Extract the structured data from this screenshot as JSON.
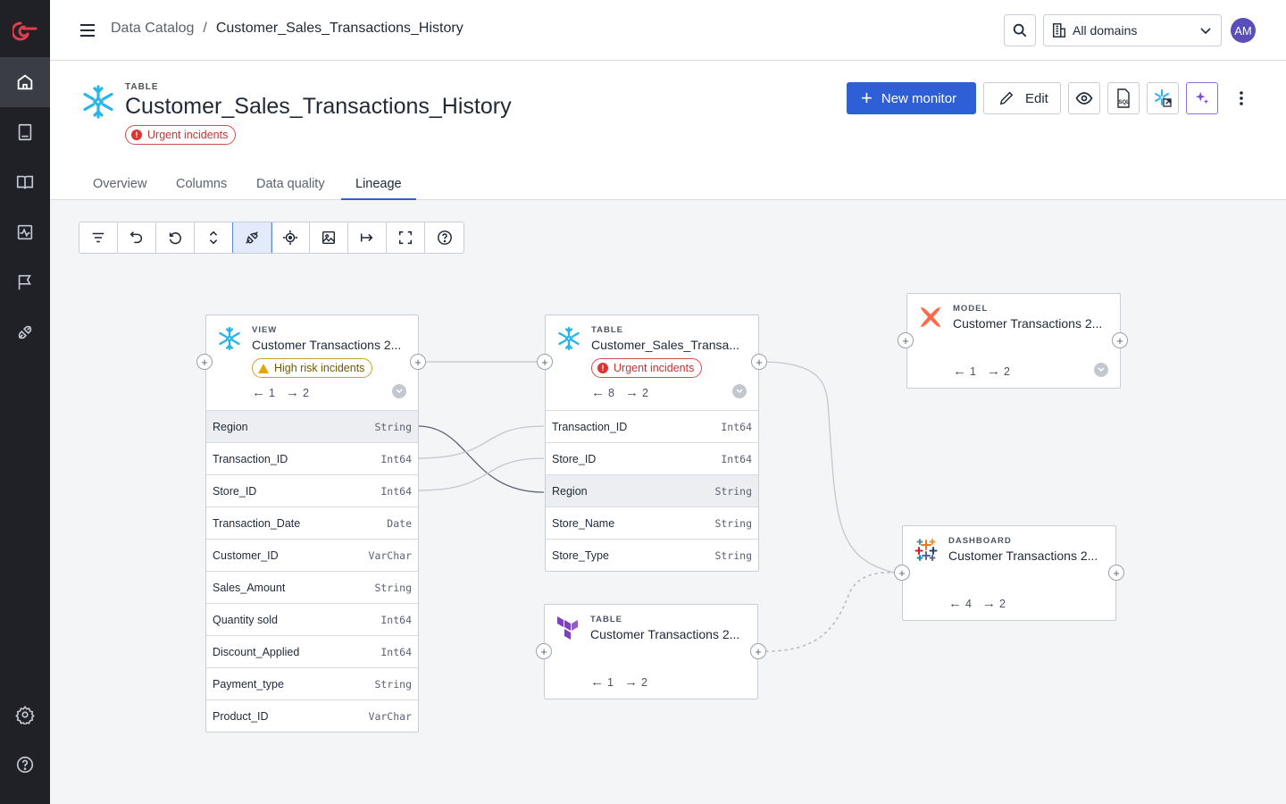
{
  "breadcrumb": {
    "root": "Data Catalog",
    "separator": "/",
    "current": "Customer_Sales_Transactions_History"
  },
  "domain_select": {
    "value": "All domains"
  },
  "user": {
    "initials": "AM"
  },
  "asset": {
    "kind": "TABLE",
    "name": "Customer_Sales_Transactions_History",
    "badge": "Urgent incidents"
  },
  "actions": {
    "new_monitor": "New monitor",
    "edit": "Edit",
    "sql_icon_text": "SQL"
  },
  "tabs": [
    "Overview",
    "Columns",
    "Data quality",
    "Lineage"
  ],
  "active_tab": "Lineage",
  "sidebar_icons": [
    "home-icon",
    "catalog-icon",
    "docs-icon",
    "monitor-icon",
    "flag-icon",
    "integrations-icon",
    "settings-icon",
    "help-icon"
  ],
  "toolbar_icons": [
    "filter-icon",
    "undo-icon",
    "reset-icon",
    "expand-collapse-icon",
    "column-lineage-icon",
    "focus-icon",
    "image-export-icon",
    "direction-icon",
    "fullscreen-icon",
    "help-icon"
  ],
  "nodes": {
    "view": {
      "kind": "VIEW",
      "title": "Customer Transactions 2...",
      "badge": "High risk incidents",
      "upstream": "1",
      "downstream": "2",
      "columns": [
        {
          "name": "Region",
          "type": "String"
        },
        {
          "name": "Transaction_ID",
          "type": "Int64"
        },
        {
          "name": "Store_ID",
          "type": "Int64"
        },
        {
          "name": "Transaction_Date",
          "type": "Date"
        },
        {
          "name": "Customer_ID",
          "type": "VarChar"
        },
        {
          "name": "Sales_Amount",
          "type": "String"
        },
        {
          "name": "Quantity sold",
          "type": "Int64"
        },
        {
          "name": "Discount_Applied",
          "type": "Int64"
        },
        {
          "name": "Payment_type",
          "type": "String"
        },
        {
          "name": "Product_ID",
          "type": "VarChar"
        }
      ]
    },
    "table_main": {
      "kind": "TABLE",
      "title": "Customer_Sales_Transa...",
      "badge": "Urgent incidents",
      "upstream": "8",
      "downstream": "2",
      "columns": [
        {
          "name": "Transaction_ID",
          "type": "Int64"
        },
        {
          "name": "Store_ID",
          "type": "Int64"
        },
        {
          "name": "Region",
          "type": "String"
        },
        {
          "name": "Store_Name",
          "type": "String"
        },
        {
          "name": "Store_Type",
          "type": "String"
        }
      ]
    },
    "model": {
      "kind": "MODEL",
      "title": "Customer Transactions 2...",
      "upstream": "1",
      "downstream": "2"
    },
    "dashboard": {
      "kind": "DASHBOARD",
      "title": "Customer Transactions 2...",
      "upstream": "4",
      "downstream": "2"
    },
    "table_tf": {
      "kind": "TABLE",
      "title": "Customer Transactions 2...",
      "upstream": "1",
      "downstream": "2"
    }
  },
  "colors": {
    "accent": "#2f5fd6",
    "sidebar": "#1f2127",
    "urgent": "#d33333",
    "warning": "#e0a800",
    "snowflake": "#29b5e8",
    "dbt": "#ff694a",
    "terraform": "#7b42bc"
  }
}
